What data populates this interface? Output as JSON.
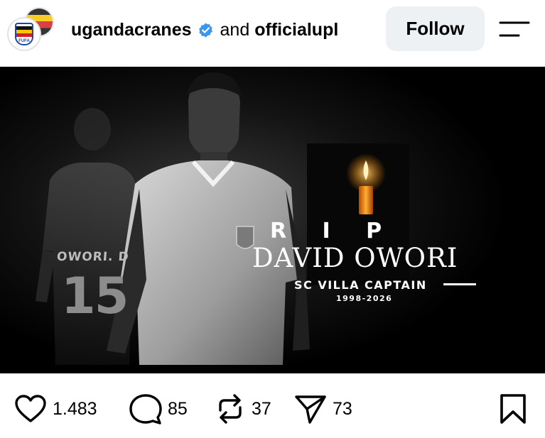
{
  "header": {
    "owner_primary": "ugandacranes",
    "owner_connector": "and",
    "owner_secondary": "officialupl",
    "verified_icon": "verified-badge-icon",
    "follow_label": "Follow",
    "menu_icon": "menu-lines-icon",
    "avatar_text": "FUFA"
  },
  "post_image": {
    "rip_label": "R I P",
    "name": "DAVID OWORI",
    "role": "SC VILLA CAPTAIN",
    "years": "1998-2026",
    "jersey_name": "OWORI. D",
    "jersey_number": "15"
  },
  "actions": {
    "likes": {
      "icon": "heart-icon",
      "count": "1.483"
    },
    "comments": {
      "icon": "comment-icon",
      "count": "85"
    },
    "reposts": {
      "icon": "repost-icon",
      "count": "37"
    },
    "shares": {
      "icon": "send-icon",
      "count": "73"
    },
    "save_icon": "bookmark-icon"
  },
  "colors": {
    "verified": "#3897f0",
    "follow_bg": "#eef1f4",
    "image_bg": "#000000"
  }
}
